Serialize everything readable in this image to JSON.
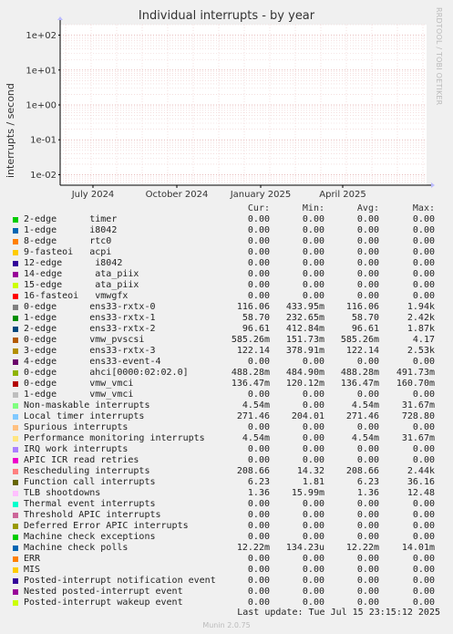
{
  "chart_data": {
    "type": "line",
    "title": "Individual interrupts - by year",
    "ylabel": "interrupts / second",
    "y_scale": "log",
    "ylim": [
      0.005,
      200
    ],
    "y_ticks": [
      "1e+02",
      "1e+01",
      "1e+00",
      "1e-01",
      "1e-02"
    ],
    "x_ticks": [
      "July 2024",
      "October 2024",
      "January 2025",
      "April 2025"
    ],
    "grid": true,
    "columns": [
      "Cur:",
      "Min:",
      "Avg:",
      "Max:"
    ],
    "series": [
      {
        "name": "2-edge      timer",
        "color": "#00cc00",
        "cur": "0.00",
        "min": "0.00",
        "avg": "0.00",
        "max": "0.00"
      },
      {
        "name": "1-edge      i8042",
        "color": "#0066b3",
        "cur": "0.00",
        "min": "0.00",
        "avg": "0.00",
        "max": "0.00"
      },
      {
        "name": "8-edge      rtc0",
        "color": "#ff8000",
        "cur": "0.00",
        "min": "0.00",
        "avg": "0.00",
        "max": "0.00"
      },
      {
        "name": "9-fasteoi   acpi",
        "color": "#ffcc00",
        "cur": "0.00",
        "min": "0.00",
        "avg": "0.00",
        "max": "0.00"
      },
      {
        "name": "12-edge      i8042",
        "color": "#330099",
        "cur": "0.00",
        "min": "0.00",
        "avg": "0.00",
        "max": "0.00"
      },
      {
        "name": "14-edge      ata_piix",
        "color": "#990099",
        "cur": "0.00",
        "min": "0.00",
        "avg": "0.00",
        "max": "0.00"
      },
      {
        "name": "15-edge      ata_piix",
        "color": "#ccff00",
        "cur": "0.00",
        "min": "0.00",
        "avg": "0.00",
        "max": "0.00"
      },
      {
        "name": "16-fasteoi   vmwgfx",
        "color": "#ff0000",
        "cur": "0.00",
        "min": "0.00",
        "avg": "0.00",
        "max": "0.00"
      },
      {
        "name": "0-edge      ens33-rxtx-0",
        "color": "#808080",
        "cur": "116.06",
        "min": "433.95m",
        "avg": "116.06",
        "max": "1.94k"
      },
      {
        "name": "1-edge      ens33-rxtx-1",
        "color": "#008f00",
        "cur": "58.70",
        "min": "232.65m",
        "avg": "58.70",
        "max": "2.42k"
      },
      {
        "name": "2-edge      ens33-rxtx-2",
        "color": "#00487d",
        "cur": "96.61",
        "min": "412.84m",
        "avg": "96.61",
        "max": "1.87k"
      },
      {
        "name": "0-edge      vmw_pvscsi",
        "color": "#b35a00",
        "cur": "585.26m",
        "min": "151.73m",
        "avg": "585.26m",
        "max": "4.17"
      },
      {
        "name": "3-edge      ens33-rxtx-3",
        "color": "#b38f00",
        "cur": "122.14",
        "min": "378.91m",
        "avg": "122.14",
        "max": "2.53k"
      },
      {
        "name": "4-edge      ens33-event-4",
        "color": "#6b006b",
        "cur": "0.00",
        "min": "0.00",
        "avg": "0.00",
        "max": "0.00"
      },
      {
        "name": "0-edge      ahci[0000:02:02.0]",
        "color": "#8fb300",
        "cur": "488.28m",
        "min": "484.90m",
        "avg": "488.28m",
        "max": "491.73m"
      },
      {
        "name": "0-edge      vmw_vmci",
        "color": "#b30000",
        "cur": "136.47m",
        "min": "120.12m",
        "avg": "136.47m",
        "max": "160.70m"
      },
      {
        "name": "1-edge      vmw_vmci",
        "color": "#bebebe",
        "cur": "0.00",
        "min": "0.00",
        "avg": "0.00",
        "max": "0.00"
      },
      {
        "name": "Non-maskable interrupts",
        "color": "#80ff80",
        "cur": "4.54m",
        "min": "0.00",
        "avg": "4.54m",
        "max": "31.67m"
      },
      {
        "name": "Local timer interrupts",
        "color": "#80c9ff",
        "cur": "271.46",
        "min": "204.01",
        "avg": "271.46",
        "max": "728.80"
      },
      {
        "name": "Spurious interrupts",
        "color": "#ffc080",
        "cur": "0.00",
        "min": "0.00",
        "avg": "0.00",
        "max": "0.00"
      },
      {
        "name": "Performance monitoring interrupts",
        "color": "#ffe680",
        "cur": "4.54m",
        "min": "0.00",
        "avg": "4.54m",
        "max": "31.67m"
      },
      {
        "name": "IRQ work interrupts",
        "color": "#aa80ff",
        "cur": "0.00",
        "min": "0.00",
        "avg": "0.00",
        "max": "0.00"
      },
      {
        "name": "APIC ICR read retries",
        "color": "#ee00cc",
        "cur": "0.00",
        "min": "0.00",
        "avg": "0.00",
        "max": "0.00"
      },
      {
        "name": "Rescheduling interrupts",
        "color": "#ff8080",
        "cur": "208.66",
        "min": "14.32",
        "avg": "208.66",
        "max": "2.44k"
      },
      {
        "name": "Function call interrupts",
        "color": "#666600",
        "cur": "6.23",
        "min": "1.81",
        "avg": "6.23",
        "max": "36.16"
      },
      {
        "name": "TLB shootdowns",
        "color": "#ffbfff",
        "cur": "1.36",
        "min": "15.99m",
        "avg": "1.36",
        "max": "12.48"
      },
      {
        "name": "Thermal event interrupts",
        "color": "#00ffcc",
        "cur": "0.00",
        "min": "0.00",
        "avg": "0.00",
        "max": "0.00"
      },
      {
        "name": "Threshold APIC interrupts",
        "color": "#cc6699",
        "cur": "0.00",
        "min": "0.00",
        "avg": "0.00",
        "max": "0.00"
      },
      {
        "name": "Deferred Error APIC interrupts",
        "color": "#999900",
        "cur": "0.00",
        "min": "0.00",
        "avg": "0.00",
        "max": "0.00"
      },
      {
        "name": "Machine check exceptions",
        "color": "#00cc00",
        "cur": "0.00",
        "min": "0.00",
        "avg": "0.00",
        "max": "0.00"
      },
      {
        "name": "Machine check polls",
        "color": "#0066b3",
        "cur": "12.22m",
        "min": "134.23u",
        "avg": "12.22m",
        "max": "14.01m"
      },
      {
        "name": "ERR",
        "color": "#ff8000",
        "cur": "0.00",
        "min": "0.00",
        "avg": "0.00",
        "max": "0.00"
      },
      {
        "name": "MIS",
        "color": "#ffcc00",
        "cur": "0.00",
        "min": "0.00",
        "avg": "0.00",
        "max": "0.00"
      },
      {
        "name": "Posted-interrupt notification event",
        "color": "#330099",
        "cur": "0.00",
        "min": "0.00",
        "avg": "0.00",
        "max": "0.00"
      },
      {
        "name": "Nested posted-interrupt event",
        "color": "#990099",
        "cur": "0.00",
        "min": "0.00",
        "avg": "0.00",
        "max": "0.00"
      },
      {
        "name": "Posted-interrupt wakeup event",
        "color": "#ccff00",
        "cur": "0.00",
        "min": "0.00",
        "avg": "0.00",
        "max": "0.00"
      }
    ]
  },
  "side_label": "RRDTOOL / TOBI OETIKER",
  "last_update": "Last update: Tue Jul 15 23:15:12 2025",
  "footer": "Munin 2.0.75"
}
